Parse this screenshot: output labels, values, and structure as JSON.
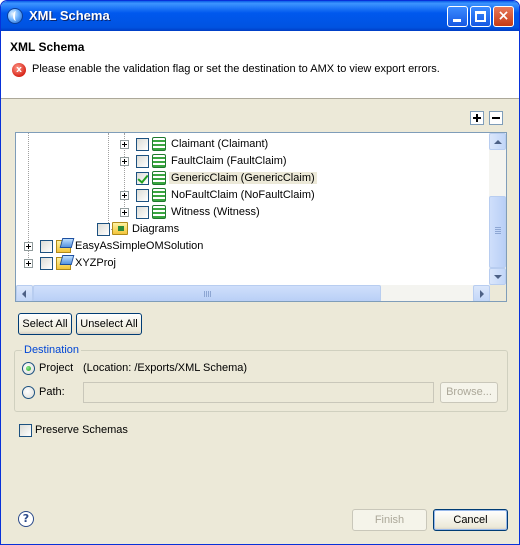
{
  "window": {
    "title": "XML Schema",
    "controls": {
      "minimize": "minimize",
      "maximize": "maximize",
      "close": "×"
    }
  },
  "banner": {
    "title": "XML Schema",
    "error_icon": "x",
    "message": "Please enable the validation flag or set the destination to AMX to view export errors."
  },
  "tree": {
    "expand_all": "expand-all",
    "collapse_all": "collapse-all",
    "items": [
      {
        "label": "Claimant (Claimant)",
        "checked": false,
        "icon": "class-icon"
      },
      {
        "label": "FaultClaim (FaultClaim)",
        "checked": false,
        "icon": "class-icon"
      },
      {
        "label": "GenericClaim (GenericClaim)",
        "checked": true,
        "icon": "class-icon",
        "selected": true
      },
      {
        "label": "NoFaultClaim (NoFaultClaim)",
        "checked": false,
        "icon": "class-icon"
      },
      {
        "label": "Witness (Witness)",
        "checked": false,
        "icon": "class-icon"
      },
      {
        "label": "Diagrams",
        "checked": false,
        "icon": "folder-icon"
      },
      {
        "label": "EasyAsSimpleOMSolution",
        "checked": false,
        "icon": "project-icon"
      },
      {
        "label": "XYZProj",
        "checked": false,
        "icon": "project-icon"
      }
    ],
    "hscroll_grip": "III"
  },
  "buttons": {
    "select_all": "Select All",
    "unselect_all": "Unselect All"
  },
  "destination": {
    "legend": "Destination",
    "project_label": "Project",
    "project_location": "(Location: /Exports/XML Schema)",
    "path_label": "Path:",
    "path_value": "",
    "browse": "Browse..."
  },
  "options": {
    "preserve_schemas": "Preserve Schemas"
  },
  "footer": {
    "help": "?",
    "finish": "Finish",
    "cancel": "Cancel"
  }
}
